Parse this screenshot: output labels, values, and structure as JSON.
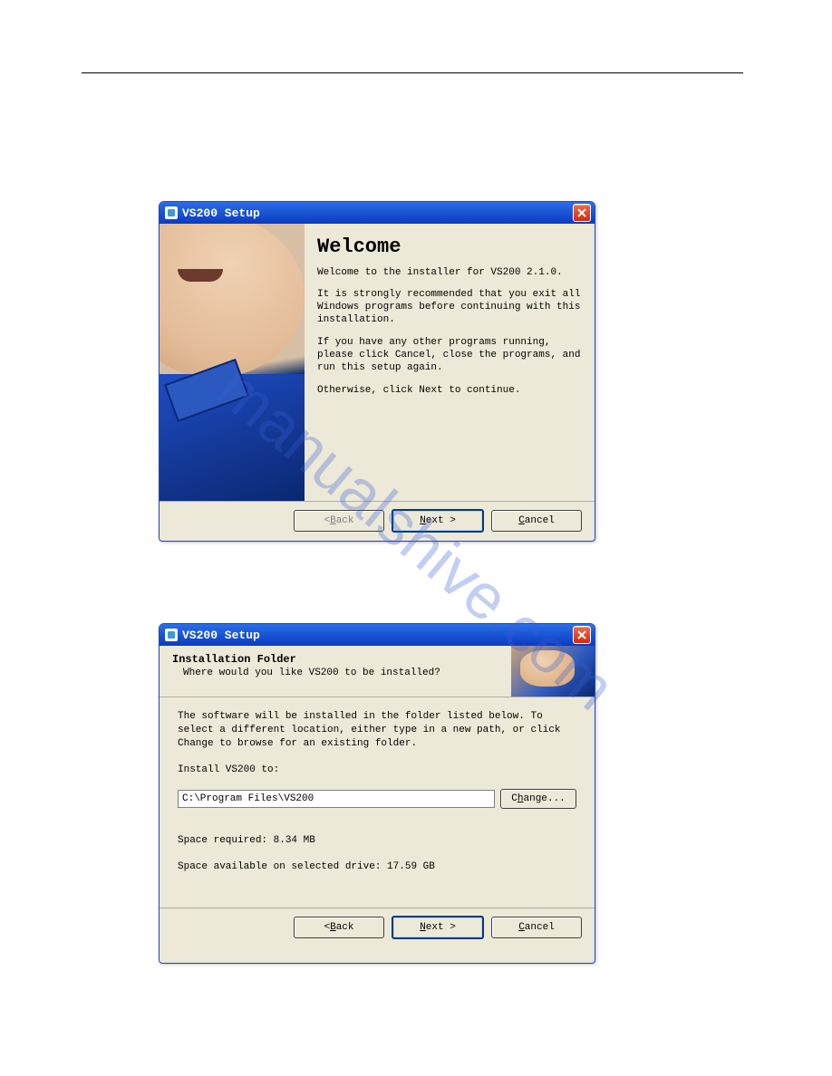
{
  "watermark": "manualshive.com",
  "dialog1": {
    "title": "VS200 Setup",
    "heading": "Welcome",
    "p1": "Welcome to the installer for VS200 2.1.0.",
    "p2": "It is strongly recommended that you exit all Windows programs before continuing with this installation.",
    "p3": "If you have any other programs running, please click Cancel, close the programs, and run this setup again.",
    "p4": "Otherwise, click Next to continue.",
    "back": "< Back",
    "next": "Next >",
    "cancel": "Cancel"
  },
  "dialog2": {
    "title": "VS200 Setup",
    "header_bold": "Installation Folder",
    "header_sub": "Where would you like VS200 to be installed?",
    "body_p1": "The software will be installed in the folder listed below. To select a different location, either type in a new path, or click Change to browse for an existing folder.",
    "install_label": "Install VS200 to:",
    "path": "C:\\Program Files\\VS200",
    "change": "Change...",
    "space_req": "Space required: 8.34 MB",
    "space_avail": "Space available on selected drive: 17.59 GB",
    "back": "< Back",
    "next": "Next >",
    "cancel": "Cancel"
  }
}
